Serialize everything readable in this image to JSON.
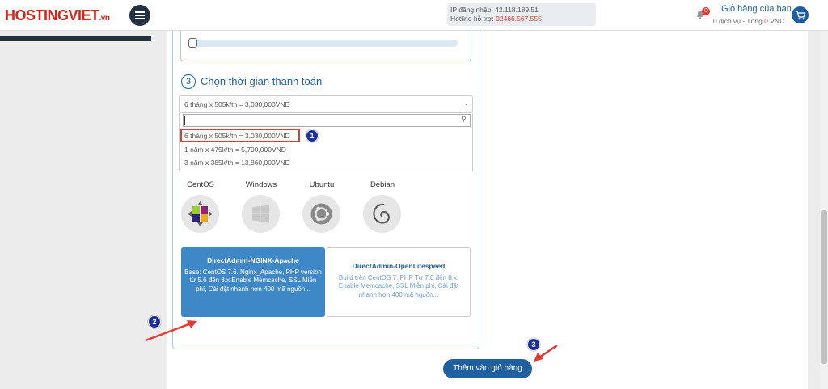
{
  "header": {
    "logo": "HOSTINGVIET",
    "logo_suffix": ".vn",
    "ip_label": "IP đăng nhập: 42.118.189.51",
    "hotline_label": "Hotline hỗ trợ: ",
    "hotline_number": "02466.567.555",
    "notification_count": "0",
    "cart_title": "Giỏ hàng của bạn",
    "cart_summary_prefix": "0 dịch vụ - Tổng ",
    "cart_total": "0",
    "cart_currency": " VND"
  },
  "payment": {
    "step_number": "3",
    "title": "Chọn thời gian thanh toán",
    "selected": "6 tháng x 505k/th = 3,030,000VND",
    "search_placeholder": "",
    "options": [
      "6 tháng x 505k/th = 3,030,000VND",
      "1 năm x 475k/th = 5,700,000VND",
      "3 năm x 385k/th = 13,860,000VND"
    ]
  },
  "os": [
    "CentOS",
    "Windows",
    "Ubuntu",
    "Debian"
  ],
  "templates": [
    {
      "title": "DirectAdmin-NGINX-Apache",
      "desc": "Base: CentOS 7.6. Nginx_Apache, PHP version từ 5.6 đến 8.x Enable Memcache, SSL Miễn phí, Cài đặt nhanh hơn 400 mã nguồn..."
    },
    {
      "title": "DirectAdmin-OpenLitespeed",
      "desc": "Build trên CentOS 7. PHP Từ 7.0 đến 8.x. Enable Memcache, SSL Miễn phí, Cài đặt nhanh hơn 400 mã nguồn..."
    }
  ],
  "annotations": [
    "1",
    "2",
    "3"
  ],
  "add_to_cart": "Thêm vào giỏ hàng",
  "colors": {
    "brand_red": "#d9261c",
    "primary_blue": "#1f5f9f",
    "selected_card": "#3f88c7",
    "marker": "#1d2f9a"
  }
}
